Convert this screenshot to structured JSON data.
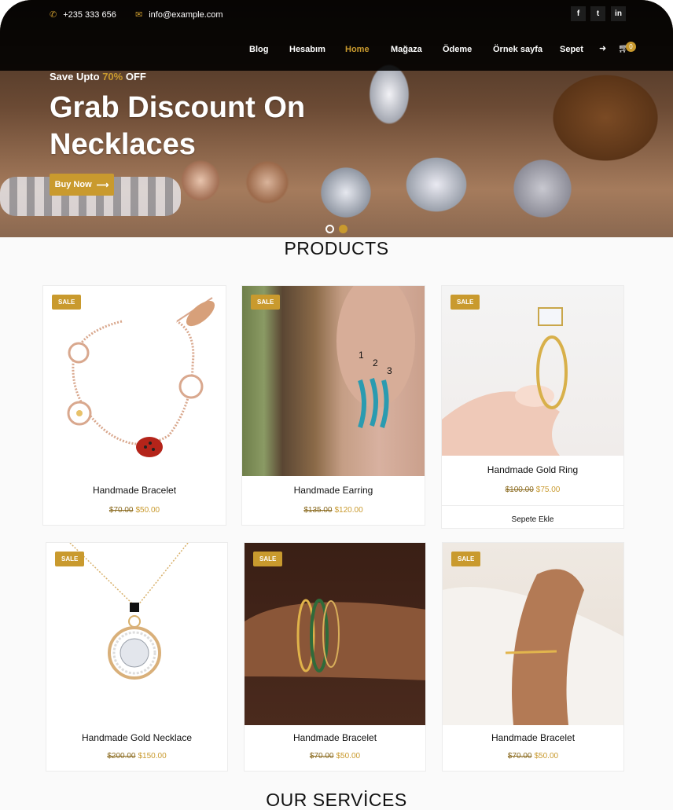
{
  "topbar": {
    "phone": "+235 333 656",
    "email": "info@example.com",
    "social": [
      "f",
      "t",
      "in"
    ]
  },
  "nav": {
    "items": [
      "Blog",
      "Hesabım",
      "Home",
      "Mağaza",
      "Ödeme",
      "Örnek sayfa",
      "Sepet"
    ],
    "active": "Home",
    "cart_count": "0"
  },
  "hero": {
    "promo_prefix": "Save Upto ",
    "promo_percent": "70%",
    "promo_suffix": " OFF",
    "headline": "Grab Discount On Necklaces",
    "button": "Buy Now"
  },
  "products": {
    "title": "PRODUCTS",
    "sale_label": "SALE",
    "items": [
      {
        "name": "Handmade Bracelet",
        "old_price": "$70.00",
        "new_price": "$50.00"
      },
      {
        "name": "Handmade Earring",
        "old_price": "$135.00",
        "new_price": "$120.00"
      },
      {
        "name": "Handmade Gold Ring",
        "old_price": "$100.00",
        "new_price": "$75.00",
        "add_to_cart": "Sepete Ekle"
      },
      {
        "name": "Handmade Gold Necklace",
        "old_price": "$200.00",
        "new_price": "$150.00"
      },
      {
        "name": "Handmade Bracelet",
        "old_price": "$70.00",
        "new_price": "$50.00"
      },
      {
        "name": "Handmade Bracelet",
        "old_price": "$70.00",
        "new_price": "$50.00"
      }
    ]
  },
  "services": {
    "title": "OUR SERVİCES"
  },
  "colors": {
    "accent": "#c99a2e",
    "topbar": "#000000"
  }
}
